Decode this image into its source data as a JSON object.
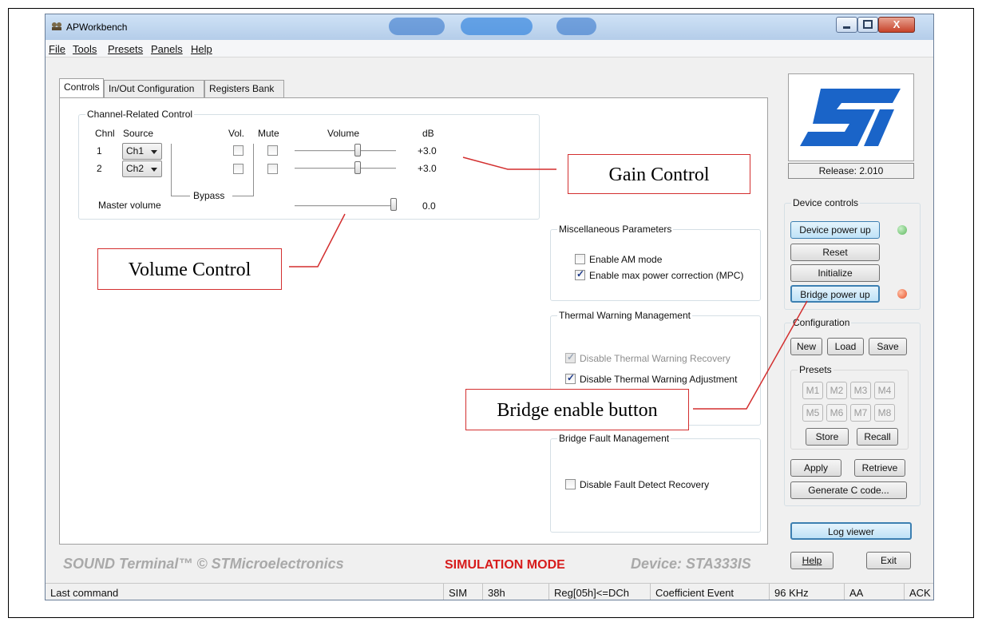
{
  "window": {
    "title": "APWorkbench",
    "controls": {
      "minimize": "–",
      "maximize": "□",
      "close": "X"
    }
  },
  "menu": {
    "items": [
      {
        "label": "File"
      },
      {
        "label": "Tools"
      },
      {
        "label": "Presets"
      },
      {
        "label": "Panels"
      },
      {
        "label": "Help"
      }
    ]
  },
  "tabs": [
    {
      "label": "Controls"
    },
    {
      "label": "In/Out Configuration"
    },
    {
      "label": "Registers Bank"
    }
  ],
  "channel_control": {
    "title": "Channel-Related Control",
    "headers": {
      "chnl": "Chnl",
      "source": "Source",
      "vol": "Vol.",
      "mute": "Mute",
      "volume": "Volume",
      "db": "dB"
    },
    "rows": [
      {
        "chnl": "1",
        "source": "Ch1",
        "vol_checked": false,
        "mute_checked": false,
        "level": 0.67,
        "db": "+3.0"
      },
      {
        "chnl": "2",
        "source": "Ch2",
        "vol_checked": false,
        "mute_checked": false,
        "level": 0.67,
        "db": "+3.0"
      }
    ],
    "bypass_label": "Bypass",
    "master": {
      "label": "Master volume",
      "level": 1.0,
      "db": "0.0"
    }
  },
  "misc_params": {
    "title": "Miscellaneous Parameters",
    "options": [
      {
        "label": "Enable AM mode",
        "checked": false
      },
      {
        "label": "Enable max power correction (MPC)",
        "checked": true
      }
    ]
  },
  "thermal": {
    "title": "Thermal Warning Management",
    "options": [
      {
        "label": "Disable Thermal Warning Recovery",
        "checked": true,
        "disabled": true
      },
      {
        "label": "Disable Thermal Warning Adjustment",
        "checked": true,
        "disabled": false
      }
    ]
  },
  "bridge_fault": {
    "title": "Bridge Fault Management",
    "options": [
      {
        "label": "Disable Fault Detect Recovery",
        "checked": false
      }
    ]
  },
  "side": {
    "release": "Release:  2.010",
    "device_controls_title": "Device controls",
    "device_power_up": "Device power up",
    "reset": "Reset",
    "initialize": "Initialize",
    "bridge_power_up": "Bridge power up",
    "led_device_color": "#5cb85c",
    "led_bridge_color": "#e8532b",
    "configuration_title": "Configuration",
    "new": "New",
    "load": "Load",
    "save": "Save",
    "presets_title": "Presets",
    "presets": [
      "M1",
      "M2",
      "M3",
      "M4",
      "M5",
      "M6",
      "M7",
      "M8"
    ],
    "store": "Store",
    "recall": "Recall",
    "apply": "Apply",
    "retrieve": "Retrieve",
    "generate": "Generate C code...",
    "log_viewer": "Log viewer",
    "help": "Help",
    "exit": "Exit"
  },
  "footer": {
    "brand": "SOUND Terminal™ © STMicroelectronics",
    "mode": "SIMULATION MODE",
    "device": "Device: STA333IS"
  },
  "status": {
    "last_command": "Last command",
    "cells": [
      "SIM",
      "38h",
      "Reg[05h]<=DCh",
      "Coefficient Event",
      "96 KHz",
      "AA",
      "ACK"
    ]
  },
  "callouts": {
    "gain": "Gain Control",
    "volume": "Volume Control",
    "bridge": "Bridge enable button"
  },
  "colors": {
    "callout_border": "#d32f2f",
    "sim_mode": "#d71c1c",
    "st_blue": "#1a64c8"
  }
}
